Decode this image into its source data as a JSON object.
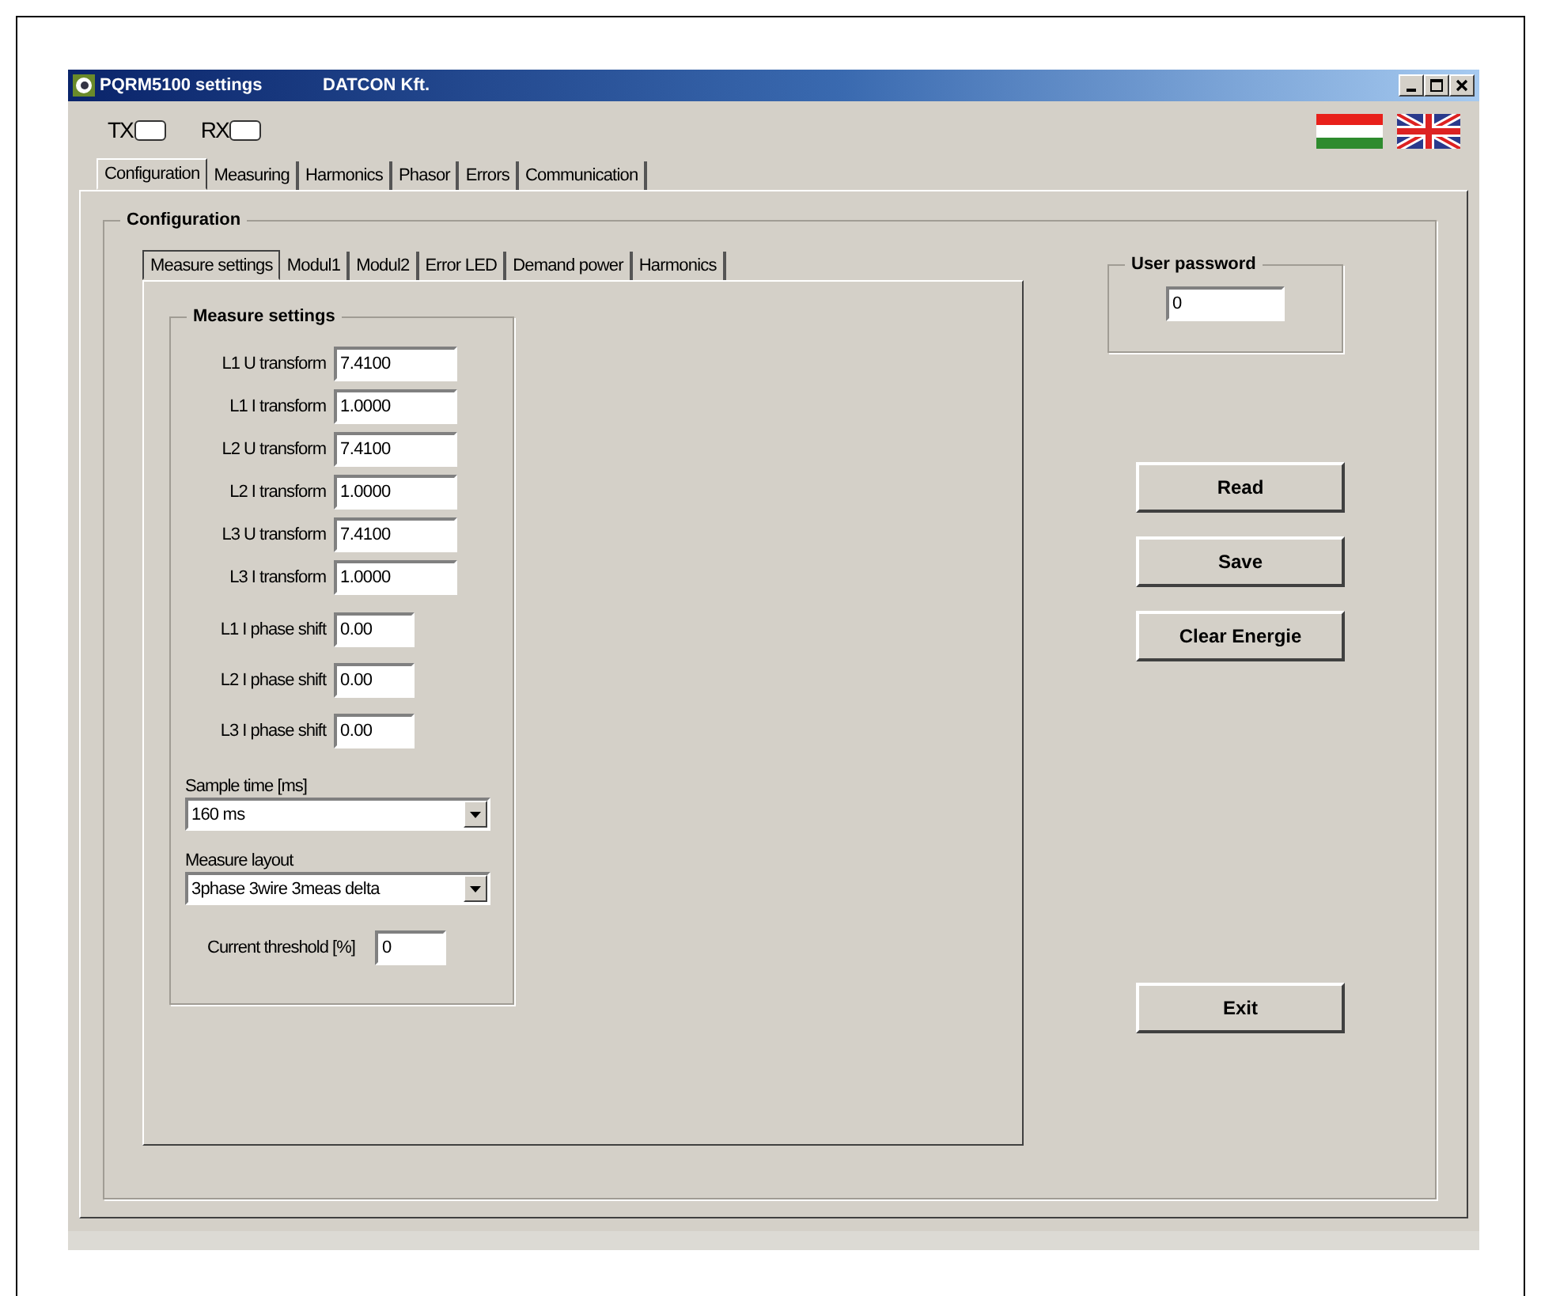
{
  "window": {
    "title": "PQRM5100 settings",
    "subtitle": "DATCON Kft."
  },
  "indicators": [
    {
      "label": "TX",
      "on": false
    },
    {
      "label": "RX",
      "on": false
    }
  ],
  "tabs": [
    {
      "label": "Configuration",
      "selected": true
    },
    {
      "label": "Measuring",
      "selected": false
    },
    {
      "label": "Harmonics",
      "selected": false
    },
    {
      "label": "Phasor",
      "selected": false
    },
    {
      "label": "Errors",
      "selected": false
    },
    {
      "label": "Communication",
      "selected": false
    }
  ],
  "group_title": "Configuration",
  "subtabs": [
    {
      "label": "Measure settings",
      "selected": true
    },
    {
      "label": "Modul1",
      "selected": false
    },
    {
      "label": "Modul2",
      "selected": false
    },
    {
      "label": "Error LED",
      "selected": false
    },
    {
      "label": "Demand power",
      "selected": false
    },
    {
      "label": "Harmonics",
      "selected": false
    }
  ],
  "measure_settings": {
    "title": "Measure settings",
    "fields": [
      {
        "label": "L1 U transform",
        "value": "7.4100",
        "kind": "transform"
      },
      {
        "label": "L1 I transform",
        "value": "1.0000",
        "kind": "transform"
      },
      {
        "label": "L2 U transform",
        "value": "7.4100",
        "kind": "transform"
      },
      {
        "label": "L2 I transform",
        "value": "1.0000",
        "kind": "transform"
      },
      {
        "label": "L3 U transform",
        "value": "7.4100",
        "kind": "transform"
      },
      {
        "label": "L3 I transform",
        "value": "1.0000",
        "kind": "transform"
      },
      {
        "label": "L1 I phase shift",
        "value": "0.00",
        "kind": "phase"
      },
      {
        "label": "L2 I phase shift",
        "value": "0.00",
        "kind": "phase"
      },
      {
        "label": "L3 I phase shift",
        "value": "0.00",
        "kind": "phase"
      }
    ],
    "selects": [
      {
        "label": "Sample time [ms]",
        "value": "160 ms"
      },
      {
        "label": "Measure layout",
        "value": "3phase 3wire 3meas delta"
      }
    ],
    "threshold": {
      "label": "Current threshold [%]",
      "value": "0"
    }
  },
  "password": {
    "title": "User password",
    "value": "0"
  },
  "buttons": [
    {
      "label": "Read"
    },
    {
      "label": "Save"
    },
    {
      "label": "Clear Energie"
    }
  ],
  "exit_button": {
    "label": "Exit"
  }
}
